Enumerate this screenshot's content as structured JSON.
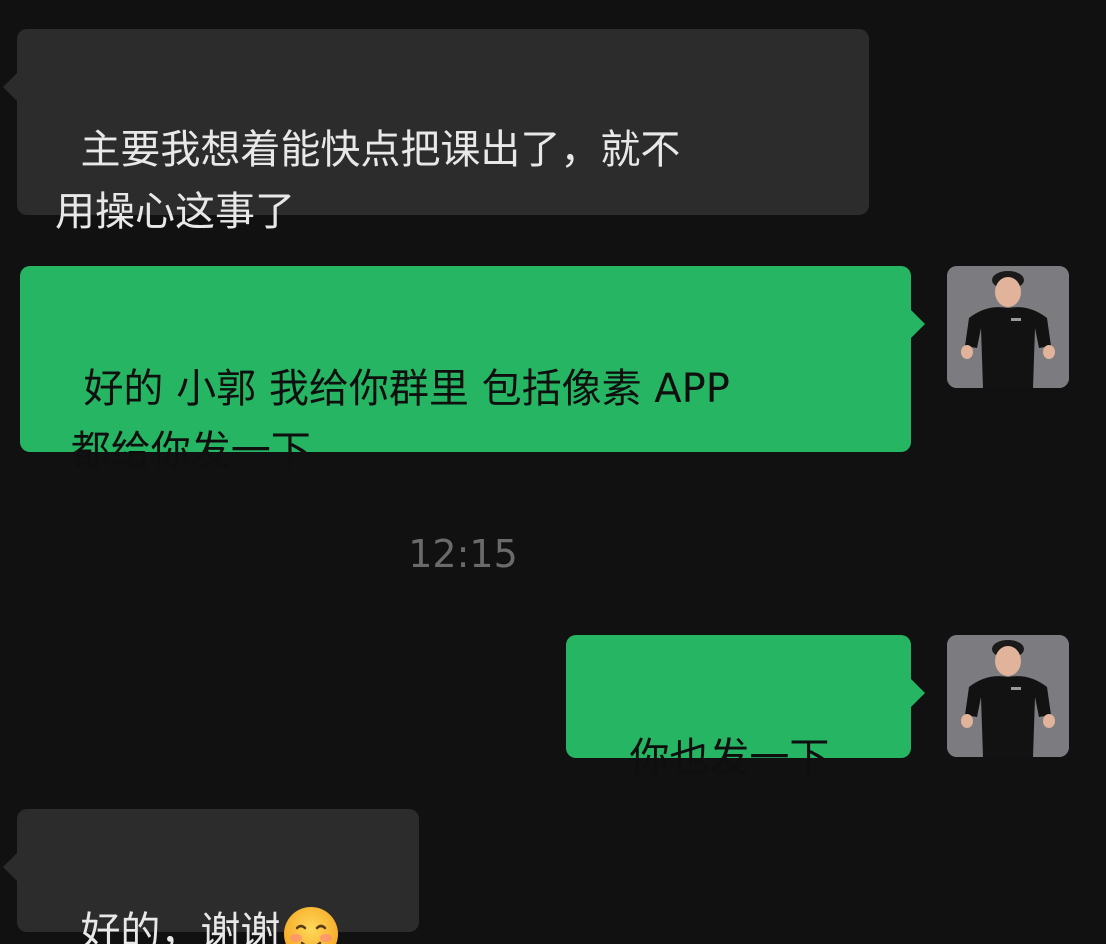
{
  "messages": [
    {
      "direction": "incoming",
      "text": "主要我想着能快点把课出了，就不\n用操心这事了"
    },
    {
      "direction": "outgoing",
      "text": "好的 小郭 我给你群里 包括像素 APP\n 都给你发一下"
    },
    {
      "direction": "outgoing",
      "text": "你也发一下"
    },
    {
      "direction": "incoming",
      "text": "好的，谢谢",
      "emoji": "smiling-face-emoji"
    }
  ],
  "timestamp": "12:15",
  "avatar": {
    "icon": "user-avatar-muscular-man"
  },
  "colors": {
    "background": "#111111",
    "incoming_bubble": "#2c2c2c",
    "outgoing_bubble": "#26b663",
    "timestamp_text": "#6a6a6a"
  }
}
